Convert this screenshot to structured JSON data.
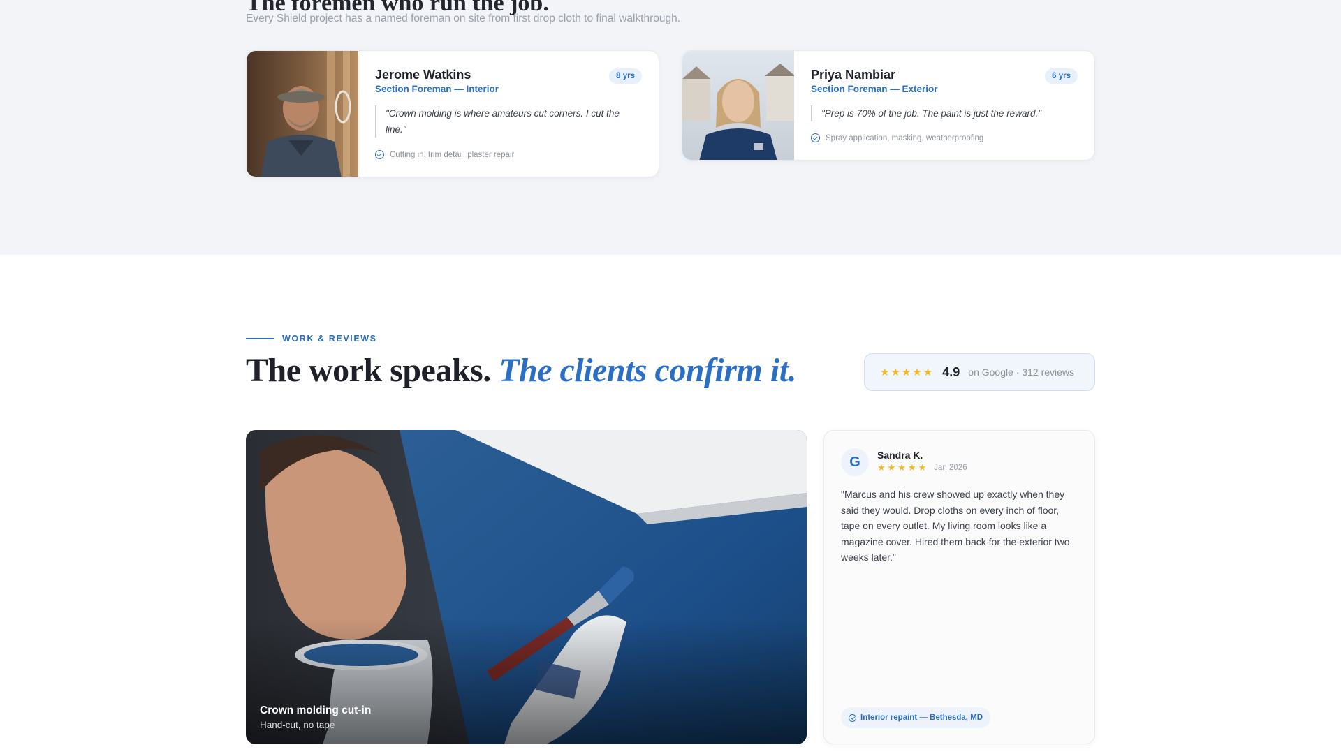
{
  "foremen": {
    "title": "The foremen who run the job.",
    "subtitle": "Every Shield project has a named foreman on site from first drop cloth to final walkthrough.",
    "cards": [
      {
        "name": "Jerome Watkins",
        "role": "Section Foreman — Interior",
        "years": "8 yrs",
        "quote": "\"Crown molding is where amateurs cut corners. I cut the line.\"",
        "skills": "Cutting in, trim detail, plaster repair"
      },
      {
        "name": "Priya Nambiar",
        "role": "Section Foreman — Exterior",
        "years": "6 yrs",
        "quote": "\"Prep is 70% of the job. The paint is just the reward.\"",
        "skills": "Spray application, masking, weatherproofing"
      }
    ]
  },
  "reviews": {
    "eyebrow": "WORK & REVIEWS",
    "headline_plain": "The work speaks. ",
    "headline_accent": "The clients confirm it.",
    "rating": {
      "stars": "★★★★★",
      "score": "4.9",
      "meta": "on Google · 312 reviews",
      "star_color": "#f3b820"
    },
    "work_photo": {
      "title": "Crown molding cut-in",
      "subtitle": "Hand-cut, no tape"
    },
    "review": {
      "source_icon": "G",
      "reviewer": "Sandra K.",
      "stars": "★★★★★",
      "date": "Jan 2026",
      "text": "\"Marcus and his crew showed up exactly when they said they would. Drop cloths on every inch of floor, tape on every outlet. My living room looks like a magazine cover. Hired them back for the exterior two weeks later.\"",
      "tag": "Interior repaint — Bethesda, MD"
    }
  },
  "colors": {
    "accent": "#2b6fc4",
    "section_bg": "#f3f4f7"
  }
}
